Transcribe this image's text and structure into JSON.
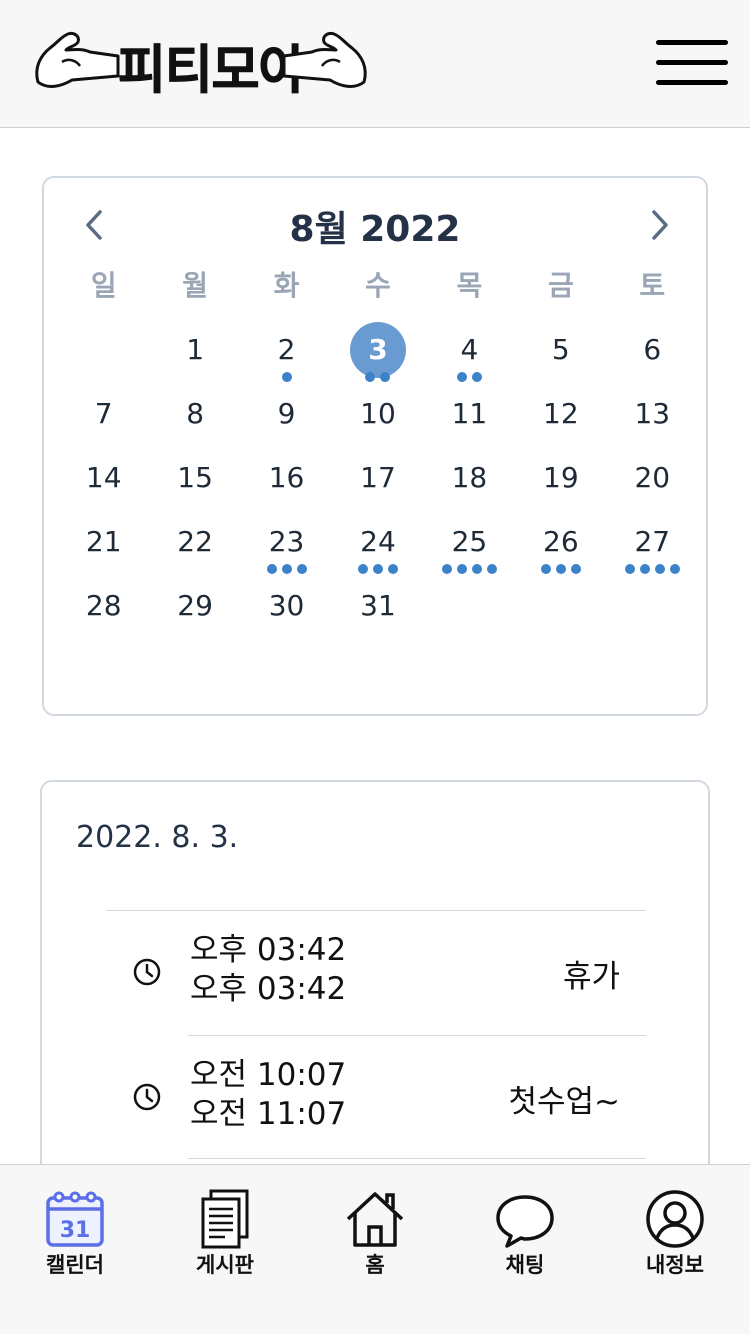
{
  "header": {
    "logo_text": "피티모아",
    "menu_icon": "hamburger-menu-icon"
  },
  "calendar": {
    "title": "8월 2022",
    "prev_icon": "chevron-left-icon",
    "next_icon": "chevron-right-icon",
    "weekdays": [
      "일",
      "월",
      "화",
      "수",
      "목",
      "금",
      "토"
    ],
    "leading_blank_days": 1,
    "selected_day": "3",
    "days": [
      {
        "label": "1",
        "events": 0
      },
      {
        "label": "2",
        "events": 1
      },
      {
        "label": "3",
        "events": 2
      },
      {
        "label": "4",
        "events": 2
      },
      {
        "label": "5",
        "events": 0
      },
      {
        "label": "6",
        "events": 0
      },
      {
        "label": "7",
        "events": 0
      },
      {
        "label": "8",
        "events": 0
      },
      {
        "label": "9",
        "events": 0
      },
      {
        "label": "10",
        "events": 0
      },
      {
        "label": "11",
        "events": 0
      },
      {
        "label": "12",
        "events": 0
      },
      {
        "label": "13",
        "events": 0
      },
      {
        "label": "14",
        "events": 0
      },
      {
        "label": "15",
        "events": 0
      },
      {
        "label": "16",
        "events": 0
      },
      {
        "label": "17",
        "events": 0
      },
      {
        "label": "18",
        "events": 0
      },
      {
        "label": "19",
        "events": 0
      },
      {
        "label": "20",
        "events": 0
      },
      {
        "label": "21",
        "events": 0
      },
      {
        "label": "22",
        "events": 0
      },
      {
        "label": "23",
        "events": 3
      },
      {
        "label": "24",
        "events": 3
      },
      {
        "label": "25",
        "events": 4
      },
      {
        "label": "26",
        "events": 3
      },
      {
        "label": "27",
        "events": 4
      },
      {
        "label": "28",
        "events": 0
      },
      {
        "label": "29",
        "events": 0
      },
      {
        "label": "30",
        "events": 0
      },
      {
        "label": "31",
        "events": 0
      }
    ],
    "colors": {
      "selected": "#6a9ad2",
      "event_dot": "#3c82c9",
      "weekday": "#9aa6b5"
    }
  },
  "events": {
    "date": "2022. 8. 3.",
    "items": [
      {
        "start": "오후 03:42",
        "end": "오후 03:42",
        "title": "휴가",
        "icon": "clock-icon"
      },
      {
        "start": "오전 10:07",
        "end": "오전 11:07",
        "title": "첫수업~",
        "icon": "clock-icon"
      }
    ]
  },
  "bottom_nav": [
    {
      "label": "캘린더",
      "icon": "calendar-icon",
      "active": true,
      "calendar_day": "31"
    },
    {
      "label": "게시판",
      "icon": "document-icon",
      "active": false
    },
    {
      "label": "홈",
      "icon": "home-icon",
      "active": false
    },
    {
      "label": "채팅",
      "icon": "chat-bubble-icon",
      "active": false
    },
    {
      "label": "내정보",
      "icon": "user-icon",
      "active": false
    }
  ]
}
